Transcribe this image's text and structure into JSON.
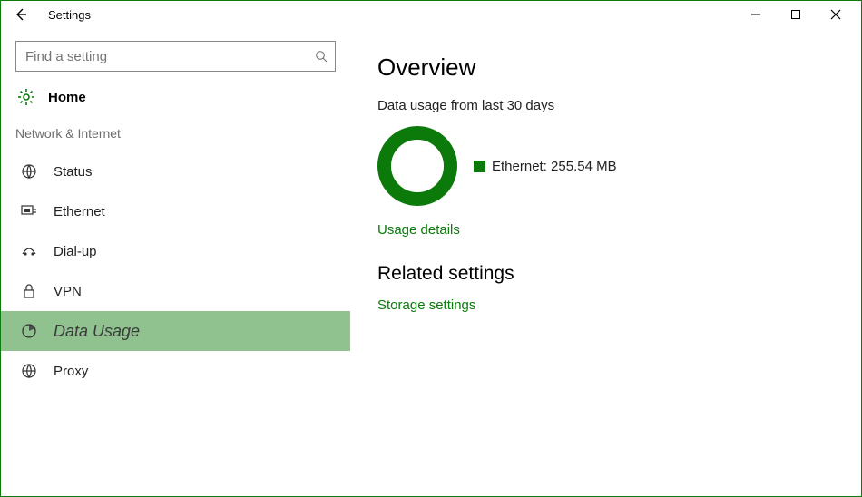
{
  "window": {
    "title": "Settings"
  },
  "search": {
    "placeholder": "Find a setting"
  },
  "home": {
    "label": "Home"
  },
  "section": {
    "title": "Network & Internet"
  },
  "nav": {
    "items": [
      {
        "label": "Status"
      },
      {
        "label": "Ethernet"
      },
      {
        "label": "Dial-up"
      },
      {
        "label": "VPN"
      },
      {
        "label": "Data Usage"
      },
      {
        "label": "Proxy"
      }
    ]
  },
  "content": {
    "heading": "Overview",
    "subtext": "Data usage from last 30 days",
    "legend_label": "Ethernet: 255.54 MB",
    "usage_link": "Usage details",
    "related_heading": "Related settings",
    "storage_link": "Storage settings"
  },
  "chart_data": {
    "type": "pie",
    "title": "Data usage from last 30 days",
    "series": [
      {
        "name": "Ethernet",
        "value_mb": 255.54,
        "fraction": 1.0,
        "color": "#0b7a0b"
      }
    ]
  }
}
